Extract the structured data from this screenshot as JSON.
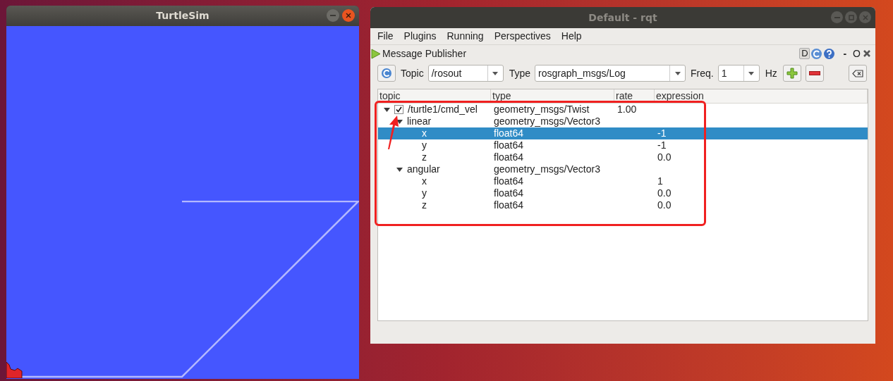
{
  "turtlesim": {
    "title": "TurtleSim"
  },
  "rqt": {
    "title": "Default - rqt",
    "menu": [
      "File",
      "Plugins",
      "Running",
      "Perspectives",
      "Help"
    ],
    "plugin": {
      "title": "Message Publisher",
      "badge": "D",
      "minimize": "-",
      "float": "O"
    },
    "toolbar": {
      "topic_label": "Topic",
      "topic": "/rosout",
      "type_label": "Type",
      "type": "rosgraph_msgs/Log",
      "freq_label": "Freq.",
      "freq": "1",
      "unit": "Hz"
    },
    "tree": {
      "columns": [
        "topic",
        "type",
        "rate",
        "expression"
      ],
      "rows": [
        {
          "topic": "/turtle1/cmd_vel",
          "type": "geometry_msgs/Twist",
          "rate": "1.00",
          "checked": true,
          "expanded": true,
          "selected": false,
          "children": [
            {
              "topic": "linear",
              "type": "geometry_msgs/Vector3",
              "expanded": true,
              "selected": false,
              "children": [
                {
                  "topic": "x",
                  "type": "float64",
                  "expression": "-1",
                  "selected": true
                },
                {
                  "topic": "y",
                  "type": "float64",
                  "expression": "-1",
                  "selected": false
                },
                {
                  "topic": "z",
                  "type": "float64",
                  "expression": "0.0",
                  "selected": false
                }
              ]
            },
            {
              "topic": "angular",
              "type": "geometry_msgs/Vector3",
              "expanded": true,
              "selected": false,
              "children": [
                {
                  "topic": "x",
                  "type": "float64",
                  "expression": "1",
                  "selected": false
                },
                {
                  "topic": "y",
                  "type": "float64",
                  "expression": "0.0",
                  "selected": false
                },
                {
                  "topic": "z",
                  "type": "float64",
                  "expression": "0.0",
                  "selected": false
                }
              ]
            }
          ]
        }
      ]
    }
  }
}
